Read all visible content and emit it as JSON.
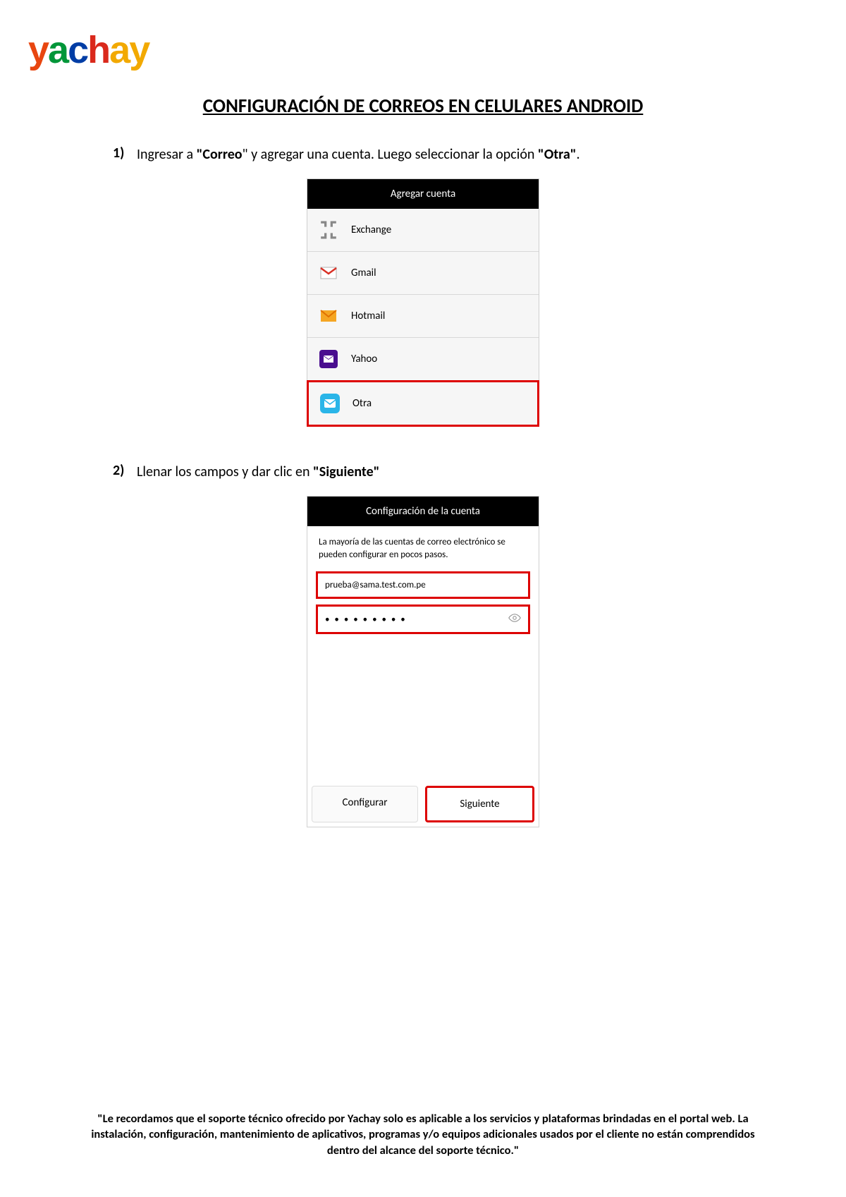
{
  "logo": {
    "letters": [
      "y",
      "a",
      "c",
      "h",
      "a",
      "y"
    ]
  },
  "title": "CONFIGURACIÓN DE CORREOS EN CELULARES ANDROID",
  "steps": [
    {
      "num": "1)",
      "parts": [
        "Ingresar a ",
        "\"Correo",
        "\" y agregar una cuenta. Luego seleccionar la opción ",
        "\"Otra\"",
        "."
      ]
    },
    {
      "num": "2)",
      "parts": [
        "Llenar los campos y dar clic en ",
        "\"Siguiente\"",
        ""
      ]
    }
  ],
  "screen1": {
    "header": "Agregar cuenta",
    "rows": [
      {
        "label": "Exchange"
      },
      {
        "label": "Gmail"
      },
      {
        "label": "Hotmail"
      },
      {
        "label": "Yahoo"
      },
      {
        "label": "Otra"
      }
    ]
  },
  "screen2": {
    "header": "Configuración de la cuenta",
    "description": "La mayoría de las cuentas de correo electrónico se pueden configurar en pocos pasos.",
    "email_value": "prueba@sama.test.com.pe",
    "password_masked": "• • • • • • • • •",
    "btn_left": "Configurar",
    "btn_right": "Siguiente"
  },
  "footer": "\"Le recordamos que el soporte técnico  ofrecido por Yachay solo es aplicable a los servicios y plataformas brindadas en el portal web. La instalación, configuración, mantenimiento de aplicativos, programas y/o equipos adicionales usados por el cliente no están comprendidos dentro del alcance del soporte técnico.\""
}
